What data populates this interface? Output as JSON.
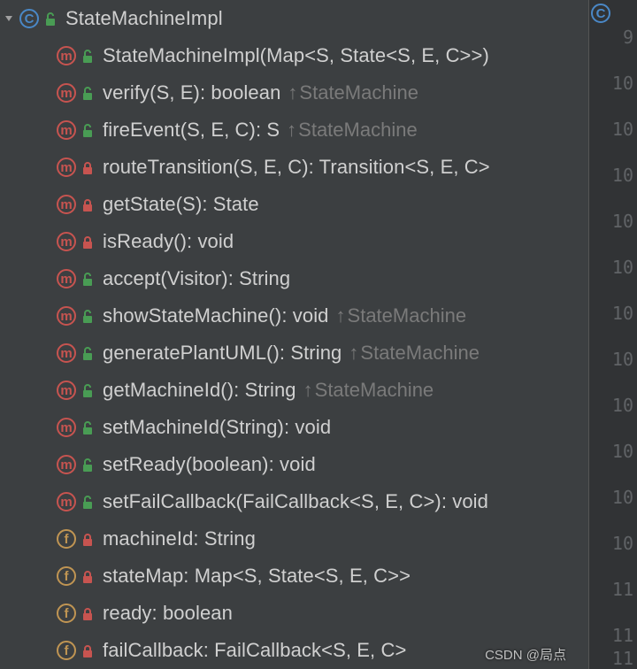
{
  "header": {
    "name": "StateMachineImpl",
    "kind": "class",
    "access": "public"
  },
  "members": [
    {
      "kind": "method",
      "access": "public",
      "signature": "StateMachineImpl(Map<S, State<S, E, C>>)",
      "inherit": null
    },
    {
      "kind": "method",
      "access": "public",
      "signature": "verify(S, E): boolean",
      "inherit": "StateMachine"
    },
    {
      "kind": "method",
      "access": "public",
      "signature": "fireEvent(S, E, C): S",
      "inherit": "StateMachine"
    },
    {
      "kind": "method",
      "access": "private",
      "signature": "routeTransition(S, E, C): Transition<S, E, C>",
      "inherit": null
    },
    {
      "kind": "method",
      "access": "private",
      "signature": "getState(S): State",
      "inherit": null
    },
    {
      "kind": "method",
      "access": "private",
      "signature": "isReady(): void",
      "inherit": null
    },
    {
      "kind": "method",
      "access": "public",
      "signature": "accept(Visitor): String",
      "inherit": null
    },
    {
      "kind": "method",
      "access": "public",
      "signature": "showStateMachine(): void",
      "inherit": "StateMachine"
    },
    {
      "kind": "method",
      "access": "public",
      "signature": "generatePlantUML(): String",
      "inherit": "StateMachine"
    },
    {
      "kind": "method",
      "access": "public",
      "signature": "getMachineId(): String",
      "inherit": "StateMachine"
    },
    {
      "kind": "method",
      "access": "public",
      "signature": "setMachineId(String): void",
      "inherit": null
    },
    {
      "kind": "method",
      "access": "public",
      "signature": "setReady(boolean): void",
      "inherit": null
    },
    {
      "kind": "method",
      "access": "public",
      "signature": "setFailCallback(FailCallback<S, E, C>): void",
      "inherit": null
    },
    {
      "kind": "field",
      "access": "private",
      "signature": "machineId: String",
      "inherit": null
    },
    {
      "kind": "field",
      "access": "private",
      "signature": "stateMap: Map<S, State<S, E, C>>",
      "inherit": null
    },
    {
      "kind": "field",
      "access": "private",
      "signature": "ready: boolean",
      "inherit": null
    },
    {
      "kind": "field",
      "access": "private",
      "signature": "failCallback: FailCallback<S, E, C>",
      "inherit": null
    }
  ],
  "gutter": {
    "lines": [
      "9",
      "",
      "10",
      "",
      "10",
      "",
      "10",
      "",
      "10",
      "",
      "10",
      "",
      "10",
      "",
      "10",
      "",
      "10",
      "",
      "10",
      "",
      "10",
      "",
      "10",
      "",
      "11",
      "",
      "11",
      "11",
      ""
    ]
  },
  "badge_letters": {
    "class": "C",
    "method": "m",
    "field": "f"
  },
  "watermark": "CSDN @局点",
  "right_badge": {
    "kind": "class"
  }
}
